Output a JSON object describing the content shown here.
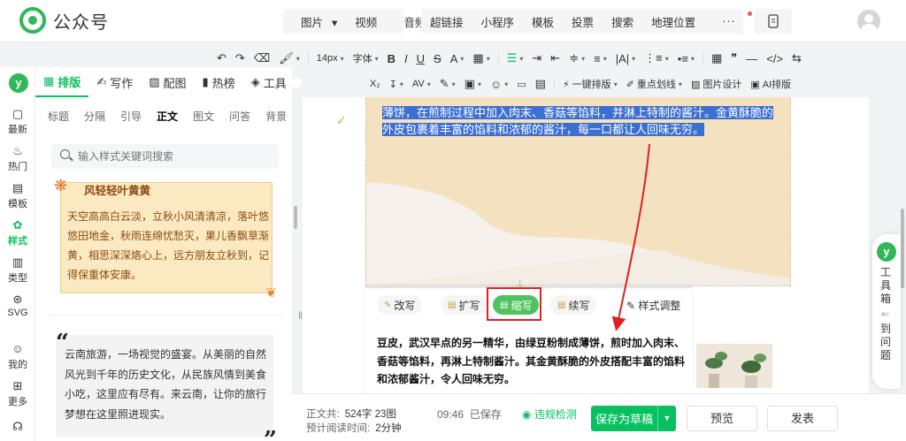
{
  "app": {
    "name": "公众号"
  },
  "topmenu": {
    "group1": [
      "图片",
      "视频",
      "音频"
    ],
    "group2": [
      "超链接",
      "小程序",
      "模板",
      "投票",
      "搜索",
      "地理位置"
    ],
    "more": "···"
  },
  "toolbar": {
    "font_size": "14px",
    "font_family": "字体",
    "one_click_layout": "一键排版",
    "highlight_line": "重点划线",
    "image_design": "图片设计",
    "ai_layout": "AI排版",
    "letter_spacing": "AV",
    "sub_script": "X₂"
  },
  "rail": {
    "logo_letter": "y",
    "items": [
      {
        "label": "最新",
        "icon": "latest-icon"
      },
      {
        "label": "热门",
        "icon": "flame-icon"
      },
      {
        "label": "模板",
        "icon": "template-icon"
      },
      {
        "label": "样式",
        "icon": "style-icon",
        "active": true
      },
      {
        "label": "类型",
        "icon": "book-icon"
      },
      {
        "label": "SVG",
        "icon": "svg-icon"
      },
      {
        "label": "我的",
        "icon": "user-icon"
      },
      {
        "label": "更多",
        "icon": "grid-icon"
      }
    ]
  },
  "panel": {
    "tabs": [
      {
        "label": "排版",
        "active": true
      },
      {
        "label": "写作"
      },
      {
        "label": "配图"
      },
      {
        "label": "热榜"
      },
      {
        "label": "工具"
      }
    ],
    "subtabs": [
      "标题",
      "分隔",
      "引导",
      "正文",
      "图文",
      "问答",
      "背景"
    ],
    "active_subtab": "正文",
    "search_placeholder": "输入样式关键词搜索",
    "template1": {
      "title": "风轻轻叶黄黄",
      "body": "天空高高白云淡，立秋小风清清凉，落叶悠悠田地金，秋雨连绵忧愁灭，果儿香飘草渐黄，相思深深烙心上，远方朋友立秋到，记得保重体安康。"
    },
    "template2": {
      "body": "云南旅游，一场视觉的盛宴。从美丽的自然风光到千年的历史文化，从民族风情到美食小吃，这里应有尽有。来云南，让你的旅行梦想在这里照进现实。"
    }
  },
  "editor": {
    "selected_text": "薄饼，在煎制过程中加入肉末、香菇等馅料，并淋上特制的酱汁。金黄酥脆的外皮包裹着丰富的馅料和浓郁的酱汁，每一口都让人回味无穷。",
    "ai_actions": [
      "改写",
      "扩写",
      "缩写",
      "续写"
    ],
    "ai_active": "缩写",
    "style_adjust": "样式调整",
    "ai_result": "豆皮，武汉早点的另一精华，由绿豆粉制成薄饼，煎时加入肉末、香菇等馅料，再淋上特制酱汁。其金黄酥脆的外皮搭配丰富的馅料和浓郁酱汁，令人回味无穷。"
  },
  "toolbox": {
    "title": "工具箱",
    "back_text": "到问题"
  },
  "footer": {
    "word_count_label": "正文共:",
    "word_count": "524字 23图",
    "read_time_label": "预计阅读时间:",
    "read_time": "2分钟",
    "save_time": "09:46",
    "saved_label": "已保存",
    "violation_check": "违规检测",
    "save_draft": "保存为草稿",
    "preview": "预览",
    "publish": "发表"
  },
  "colors": {
    "brand": "#07c160",
    "selection": "#3b6fd1",
    "highlight_box": "#e02020",
    "canvas_bg": "#f4e1bf"
  }
}
